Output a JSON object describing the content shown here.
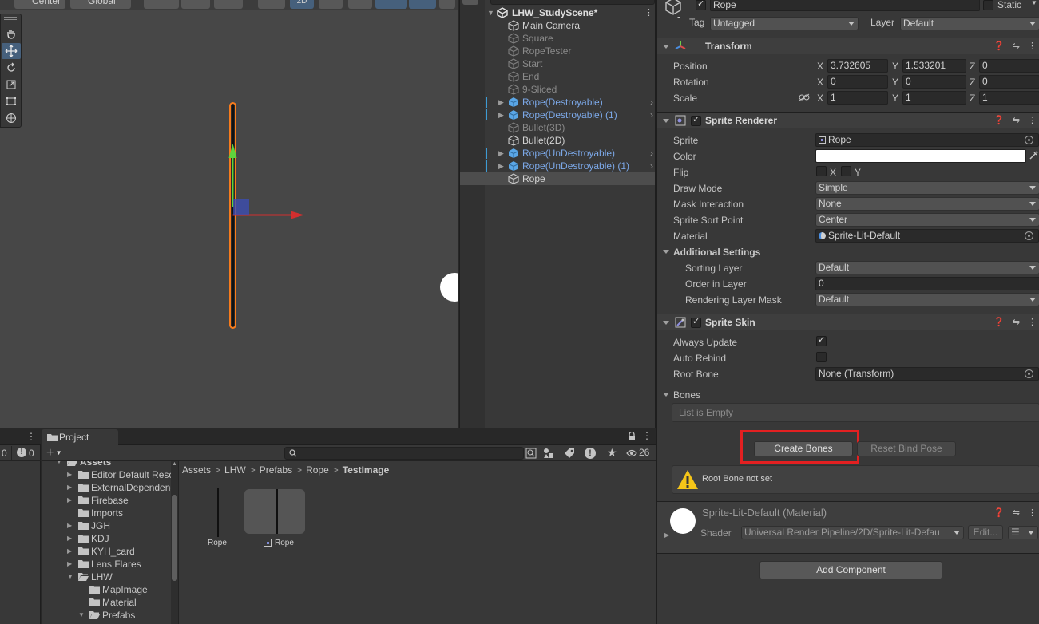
{
  "scene": {
    "toolbar": {
      "pivot_label": "Center",
      "space_label": "Global",
      "mode_2d_label": "2D"
    }
  },
  "hierarchy": {
    "scene_name": "LHW_StudyScene*",
    "items": [
      {
        "label": "Main Camera",
        "type": "gameobject",
        "dimmed": false
      },
      {
        "label": "Square",
        "type": "gameobject",
        "dimmed": true
      },
      {
        "label": "RopeTester",
        "type": "gameobject",
        "dimmed": true
      },
      {
        "label": "Start",
        "type": "gameobject",
        "dimmed": true
      },
      {
        "label": "End",
        "type": "gameobject",
        "dimmed": true
      },
      {
        "label": "9-Sliced",
        "type": "gameobject",
        "dimmed": true
      },
      {
        "label": "Rope(Destroyable)",
        "type": "prefab",
        "dimmed": false
      },
      {
        "label": "Rope(Destroyable) (1)",
        "type": "prefab",
        "dimmed": false
      },
      {
        "label": "Bullet(3D)",
        "type": "gameobject",
        "dimmed": true
      },
      {
        "label": "Bullet(2D)",
        "type": "gameobject",
        "dimmed": false
      },
      {
        "label": "Rope(UnDestroyable)",
        "type": "prefab",
        "dimmed": false
      },
      {
        "label": "Rope(UnDestroyable) (1)",
        "type": "prefab",
        "dimmed": false
      },
      {
        "label": "Rope",
        "type": "gameobject",
        "dimmed": false,
        "selected": true
      }
    ]
  },
  "project": {
    "tab_label": "Project",
    "left_panel_counts": [
      "0",
      "0"
    ],
    "hidden_count": "26",
    "tree": [
      {
        "label": "Assets",
        "depth": 0,
        "expanded": true
      },
      {
        "label": "Editor Default Resou",
        "depth": 1,
        "expanded": false
      },
      {
        "label": "ExternalDependenc",
        "depth": 1,
        "expanded": false
      },
      {
        "label": "Firebase",
        "depth": 1,
        "expanded": false
      },
      {
        "label": "Imports",
        "depth": 1,
        "expanded": null
      },
      {
        "label": "JGH",
        "depth": 1,
        "expanded": false
      },
      {
        "label": "KDJ",
        "depth": 1,
        "expanded": false
      },
      {
        "label": "KYH_card",
        "depth": 1,
        "expanded": false
      },
      {
        "label": "Lens Flares",
        "depth": 1,
        "expanded": false
      },
      {
        "label": "LHW",
        "depth": 1,
        "expanded": true
      },
      {
        "label": "MapImage",
        "depth": 2,
        "expanded": null
      },
      {
        "label": "Material",
        "depth": 2,
        "expanded": null
      },
      {
        "label": "Prefabs",
        "depth": 2,
        "expanded": true
      }
    ],
    "breadcrumb": [
      "Assets",
      "LHW",
      "Prefabs",
      "Rope",
      "TestImage"
    ],
    "assets": [
      {
        "label": "Rope",
        "kind": "image"
      },
      {
        "label": "Rope",
        "kind": "sprite"
      }
    ]
  },
  "inspector": {
    "object_name": "Rope",
    "static_label": "Static",
    "tag_label": "Tag",
    "tag_value": "Untagged",
    "layer_label": "Layer",
    "layer_value": "Default",
    "transform": {
      "title": "Transform",
      "position_label": "Position",
      "rotation_label": "Rotation",
      "scale_label": "Scale",
      "position": {
        "x": "3.732605",
        "y": "1.533201",
        "z": "0"
      },
      "rotation": {
        "x": "0",
        "y": "0",
        "z": "0"
      },
      "scale": {
        "x": "1",
        "y": "1",
        "z": "1"
      }
    },
    "sprite_renderer": {
      "title": "Sprite Renderer",
      "sprite_label": "Sprite",
      "sprite_value": "Rope",
      "color_label": "Color",
      "color_value": "#ffffff",
      "flip_label": "Flip",
      "flip_x": "X",
      "flip_y": "Y",
      "draw_mode_label": "Draw Mode",
      "draw_mode_value": "Simple",
      "mask_label": "Mask Interaction",
      "mask_value": "None",
      "sort_point_label": "Sprite Sort Point",
      "sort_point_value": "Center",
      "material_label": "Material",
      "material_value": "Sprite-Lit-Default",
      "additional_label": "Additional Settings",
      "sorting_layer_label": "Sorting Layer",
      "sorting_layer_value": "Default",
      "order_label": "Order in Layer",
      "order_value": "0",
      "rendering_mask_label": "Rendering Layer Mask",
      "rendering_mask_value": "Default"
    },
    "sprite_skin": {
      "title": "Sprite Skin",
      "always_update_label": "Always Update",
      "always_update": true,
      "auto_rebind_label": "Auto Rebind",
      "auto_rebind": false,
      "root_bone_label": "Root Bone",
      "root_bone_value": "None (Transform)",
      "bones_label": "Bones",
      "bones_empty": "List is Empty",
      "create_bones_label": "Create Bones",
      "reset_bind_pose_label": "Reset Bind Pose",
      "warning_text": "Root Bone not set"
    },
    "material": {
      "name": "Sprite-Lit-Default (Material)",
      "shader_label": "Shader",
      "shader_value": "Universal Render Pipeline/2D/Sprite-Lit-Defau",
      "edit_label": "Edit..."
    },
    "add_component_label": "Add Component"
  },
  "colors": {
    "accent_blue": "#46607c",
    "prefab_blue": "#7ba7e6",
    "highlight_red": "#e32021",
    "selection_orange": "#f77b1c",
    "warning_yellow": "#f5c518"
  }
}
